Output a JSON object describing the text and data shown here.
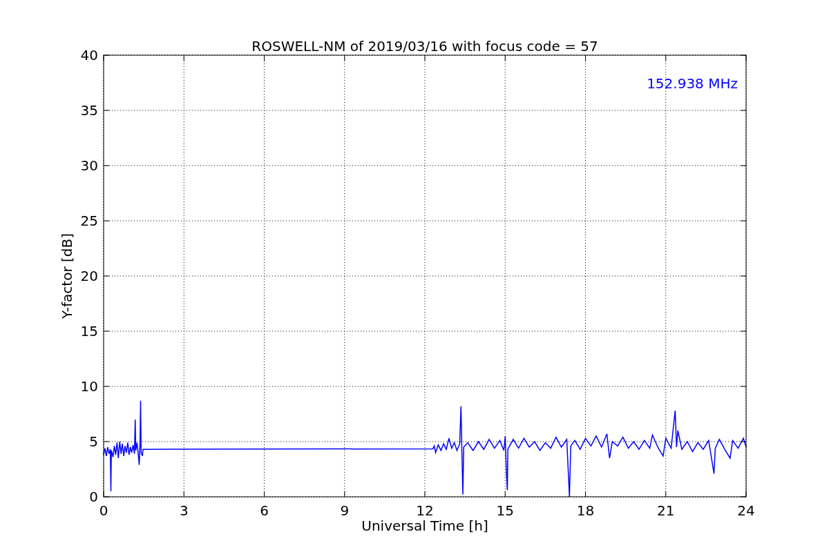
{
  "figure": {
    "chart_data": {
      "type": "line",
      "title": "ROSWELL-NM of 2019/03/16 with focus code = 57",
      "xlabel": "Universal Time [h]",
      "ylabel": "Y-factor [dB]",
      "grid": true,
      "xlim": [
        0,
        24
      ],
      "ylim": [
        0,
        40
      ],
      "xticks": [
        0,
        3,
        6,
        9,
        12,
        15,
        18,
        21,
        24
      ],
      "yticks": [
        0,
        5,
        10,
        15,
        20,
        25,
        30,
        35,
        40
      ],
      "x": [
        0,
        0.05,
        0.1,
        0.15,
        0.2,
        0.25,
        0.27,
        0.29,
        0.35,
        0.4,
        0.45,
        0.5,
        0.55,
        0.6,
        0.65,
        0.7,
        0.75,
        0.8,
        0.85,
        0.9,
        0.95,
        1.0,
        1.05,
        1.1,
        1.15,
        1.18,
        1.2,
        1.25,
        1.3,
        1.33,
        1.36,
        1.38,
        1.4,
        1.45,
        1.47,
        12.3,
        12.35,
        12.4,
        12.5,
        12.6,
        12.7,
        12.8,
        12.9,
        13.0,
        13.1,
        13.2,
        13.3,
        13.35,
        13.38,
        13.42,
        13.45,
        13.6,
        13.8,
        14.0,
        14.2,
        14.4,
        14.6,
        14.8,
        14.95,
        15.0,
        15.05,
        15.08,
        15.1,
        15.3,
        15.5,
        15.7,
        15.9,
        16.1,
        16.3,
        16.5,
        16.7,
        16.9,
        17.1,
        17.3,
        17.4,
        17.45,
        17.6,
        17.8,
        18.0,
        18.2,
        18.4,
        18.6,
        18.8,
        18.9,
        19.0,
        19.2,
        19.4,
        19.6,
        19.8,
        20.0,
        20.2,
        20.4,
        20.5,
        20.7,
        20.9,
        21.0,
        21.2,
        21.35,
        21.4,
        21.45,
        21.6,
        21.8,
        22.0,
        22.2,
        22.4,
        22.6,
        22.8,
        22.85,
        23.0,
        23.2,
        23.4,
        23.5,
        23.7,
        23.9,
        24.0
      ],
      "series": [
        {
          "name": "152.938 MHz",
          "color": "#0000ff",
          "values": [
            3.8,
            4.4,
            3.7,
            4.5,
            3.9,
            4.3,
            0.5,
            4.2,
            3.6,
            4.6,
            3.8,
            4.9,
            3.5,
            5.0,
            3.9,
            4.8,
            3.7,
            4.6,
            4.0,
            4.9,
            3.8,
            4.5,
            4.0,
            4.7,
            3.9,
            7.0,
            4.2,
            4.9,
            3.7,
            2.9,
            4.8,
            8.7,
            4.0,
            3.7,
            4.3,
            4.35,
            4.6,
            4.0,
            4.7,
            4.2,
            4.8,
            4.3,
            5.3,
            4.4,
            4.9,
            4.2,
            4.8,
            8.2,
            4.3,
            0.2,
            4.5,
            4.9,
            4.2,
            5.0,
            4.3,
            5.2,
            4.4,
            5.1,
            4.2,
            5.5,
            2.0,
            0.6,
            4.3,
            5.2,
            4.4,
            5.3,
            4.5,
            5.0,
            4.2,
            4.9,
            4.4,
            5.4,
            4.5,
            5.2,
            0,
            4.6,
            5.1,
            4.3,
            5.3,
            4.6,
            5.5,
            4.5,
            5.7,
            3.5,
            5.0,
            4.6,
            5.4,
            4.4,
            5.0,
            4.3,
            5.1,
            4.4,
            5.6,
            4.5,
            3.7,
            5.3,
            4.4,
            7.8,
            4.5,
            6.0,
            4.3,
            5.0,
            4.1,
            4.9,
            4.3,
            5.1,
            2.1,
            4.4,
            5.2,
            4.3,
            3.5,
            5.1,
            4.4,
            5.3,
            4.5
          ]
        }
      ]
    }
  }
}
